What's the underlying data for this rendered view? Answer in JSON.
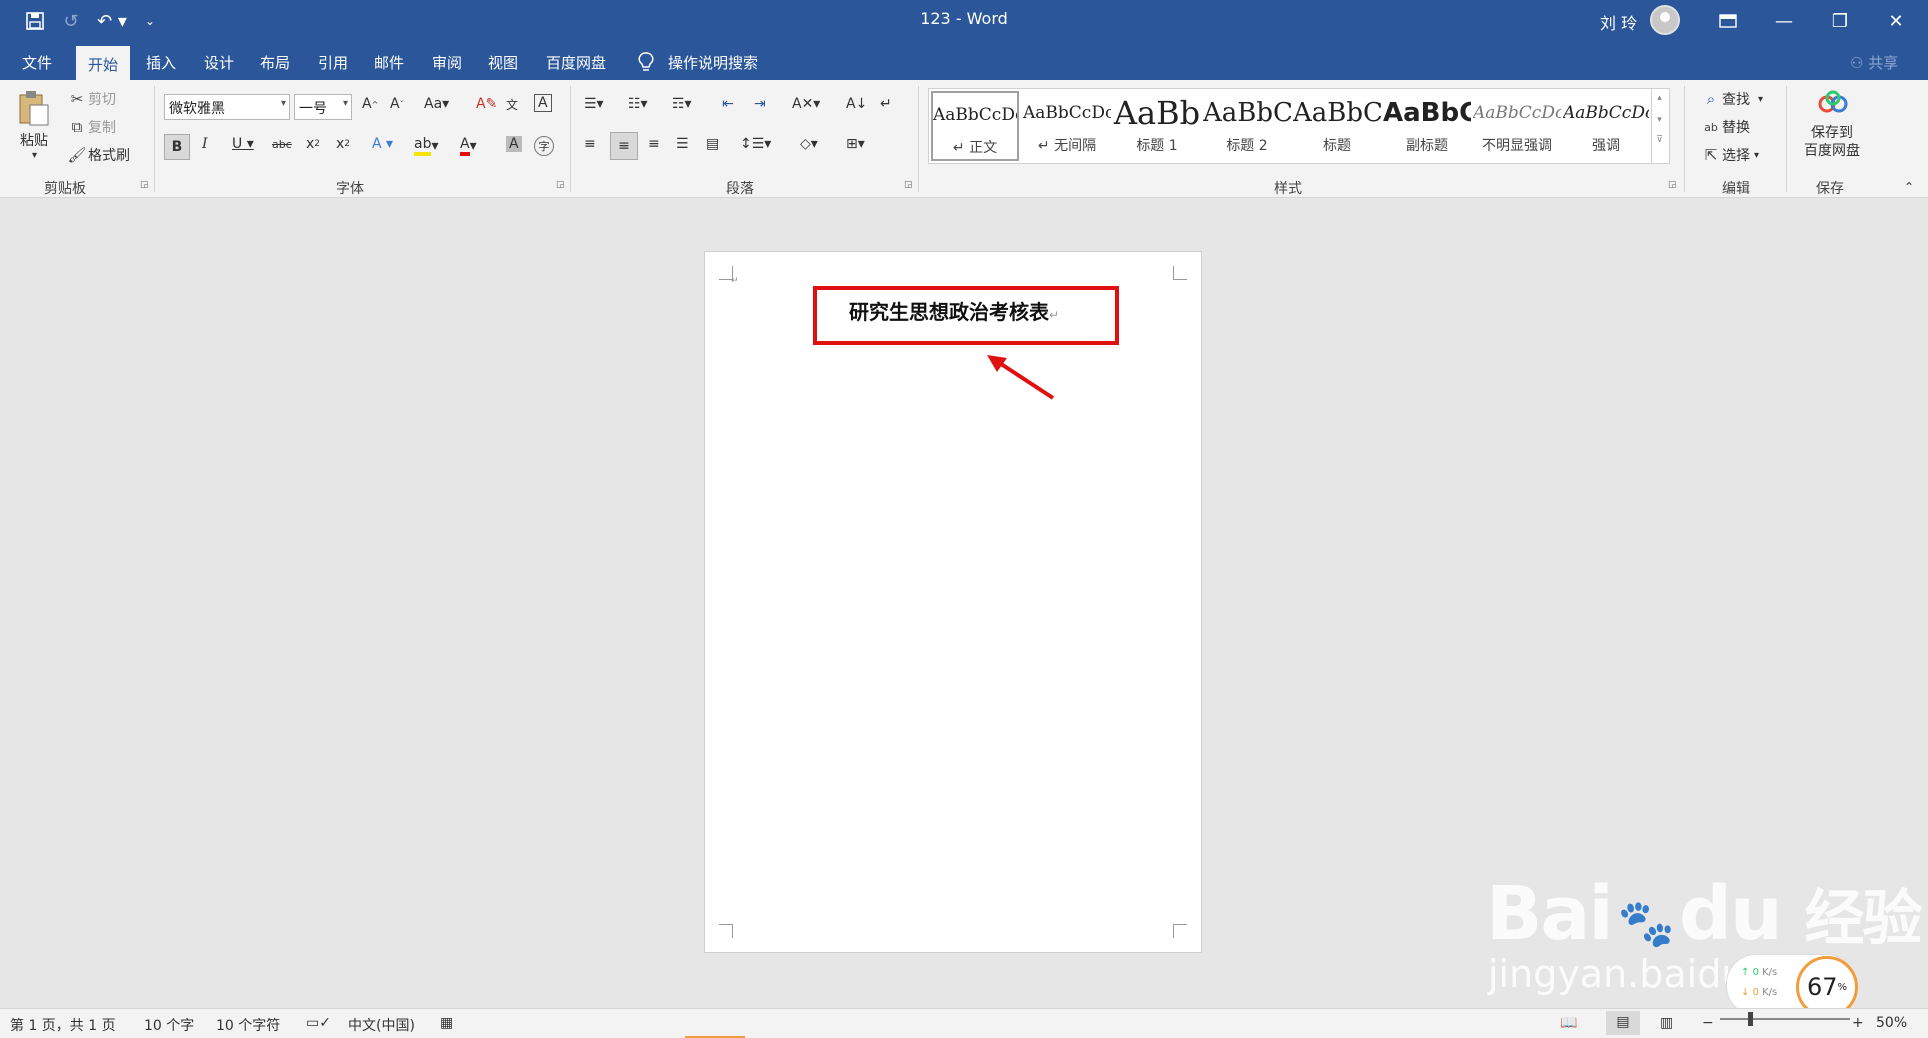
{
  "titlebar": {
    "doc_title": "123  -  Word",
    "user_name": "刘 玲"
  },
  "tabs": [
    {
      "label": "文件"
    },
    {
      "label": "开始"
    },
    {
      "label": "插入"
    },
    {
      "label": "设计"
    },
    {
      "label": "布局"
    },
    {
      "label": "引用"
    },
    {
      "label": "邮件"
    },
    {
      "label": "审阅"
    },
    {
      "label": "视图"
    },
    {
      "label": "百度网盘"
    },
    {
      "label": "操作说明搜索"
    }
  ],
  "share_label": "共享",
  "clipboard": {
    "paste": "粘贴",
    "cut": "剪切",
    "copy": "复制",
    "format_painter": "格式刷",
    "group": "剪贴板"
  },
  "font": {
    "name": "微软雅黑",
    "size": "一号",
    "group": "字体"
  },
  "paragraph": {
    "group": "段落"
  },
  "styles": {
    "group": "样式",
    "items": [
      {
        "preview": "AaBbCcDc",
        "label": "↵ 正文"
      },
      {
        "preview": "AaBbCcDc",
        "label": "↵ 无间隔"
      },
      {
        "preview": "AaBb",
        "label": "标题 1"
      },
      {
        "preview": "AaBbC",
        "label": "标题 2"
      },
      {
        "preview": "AaBbC",
        "label": "标题"
      },
      {
        "preview": "AaBbC",
        "label": "副标题"
      },
      {
        "preview": "AaBbCcDc",
        "label": "不明显强调"
      },
      {
        "preview": "AaBbCcDc",
        "label": "强调"
      }
    ]
  },
  "editing": {
    "find": "查找",
    "replace": "替换",
    "select": "选择",
    "group": "编辑"
  },
  "save": {
    "button": "保存到\n百度网盘",
    "line1": "保存到",
    "line2": "百度网盘",
    "group": "保存"
  },
  "document": {
    "heading": "研究生思想政治考核表"
  },
  "statusbar": {
    "page": "第 1 页，共 1 页",
    "words": "10 个字",
    "chars": "10 个字符",
    "language": "中文(中国)",
    "zoom": "50%"
  },
  "speed_widget": {
    "up": "0",
    "down": "0",
    "unit": "K/s",
    "percent": "67",
    "percent_sign": "%"
  },
  "watermark": {
    "brand": "Bai",
    "brand2": "du",
    "cn": "经验",
    "url": "jingyan.baidu.com"
  },
  "colors": {
    "accent": "#2b579a",
    "annotation": "#e01010"
  }
}
